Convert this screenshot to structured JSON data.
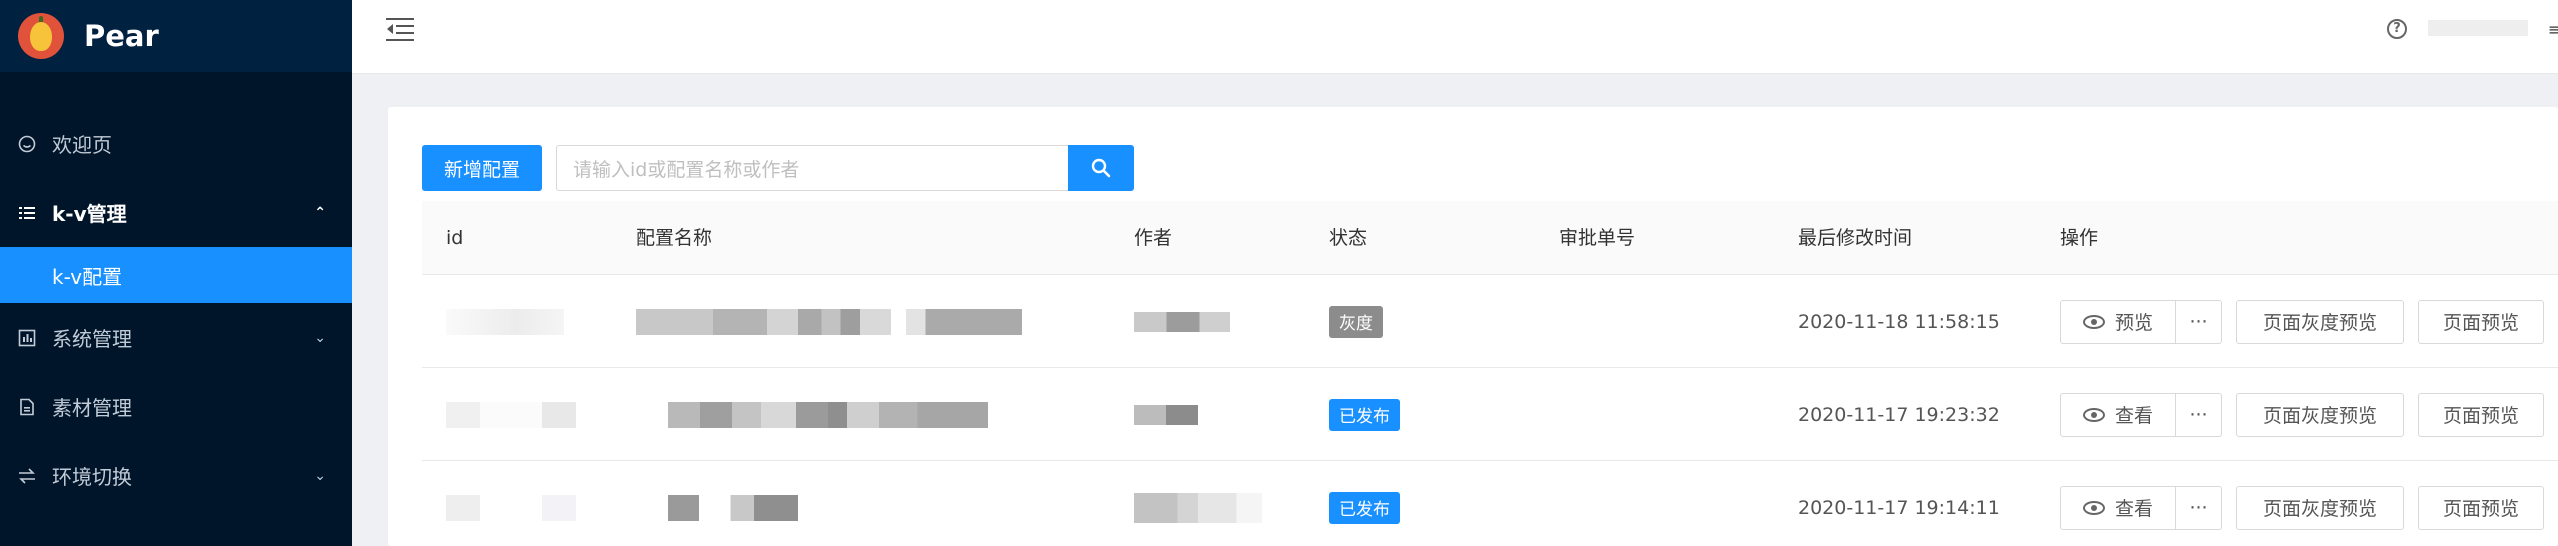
{
  "app": {
    "name": "Pear"
  },
  "sidebar": {
    "items": [
      {
        "label": "欢迎页",
        "icon": "smile-icon"
      },
      {
        "label": "k-v管理",
        "icon": "list-icon",
        "expanded": true
      },
      {
        "label": "k-v配置",
        "icon": "",
        "active": true
      },
      {
        "label": "系统管理",
        "icon": "dashboard-icon"
      },
      {
        "label": "素材管理",
        "icon": "file-icon"
      },
      {
        "label": "环境切换",
        "icon": "swap-icon"
      }
    ]
  },
  "header": {
    "help_glyph": "?"
  },
  "toolbar": {
    "add_label": "新增配置",
    "search_placeholder": "请输入id或配置名称或作者"
  },
  "table": {
    "columns": [
      "id",
      "配置名称",
      "作者",
      "状态",
      "审批单号",
      "最后修改时间",
      "操作"
    ],
    "rows": [
      {
        "status": "灰度",
        "status_color": "#8c8c8c",
        "time": "2020-11-18 11:58:15",
        "action": "预览"
      },
      {
        "status": "已发布",
        "status_color": "#1890ff",
        "time": "2020-11-17 19:23:32",
        "action": "查看"
      },
      {
        "status": "已发布",
        "status_color": "#1890ff",
        "time": "2020-11-17 19:14:11",
        "action": "查看"
      }
    ],
    "more_label": "···",
    "gray_preview_label": "页面灰度预览",
    "page_preview_label": "页面预览"
  },
  "colors": {
    "primary": "#1890ff",
    "sidebar_bg": "#001529"
  }
}
